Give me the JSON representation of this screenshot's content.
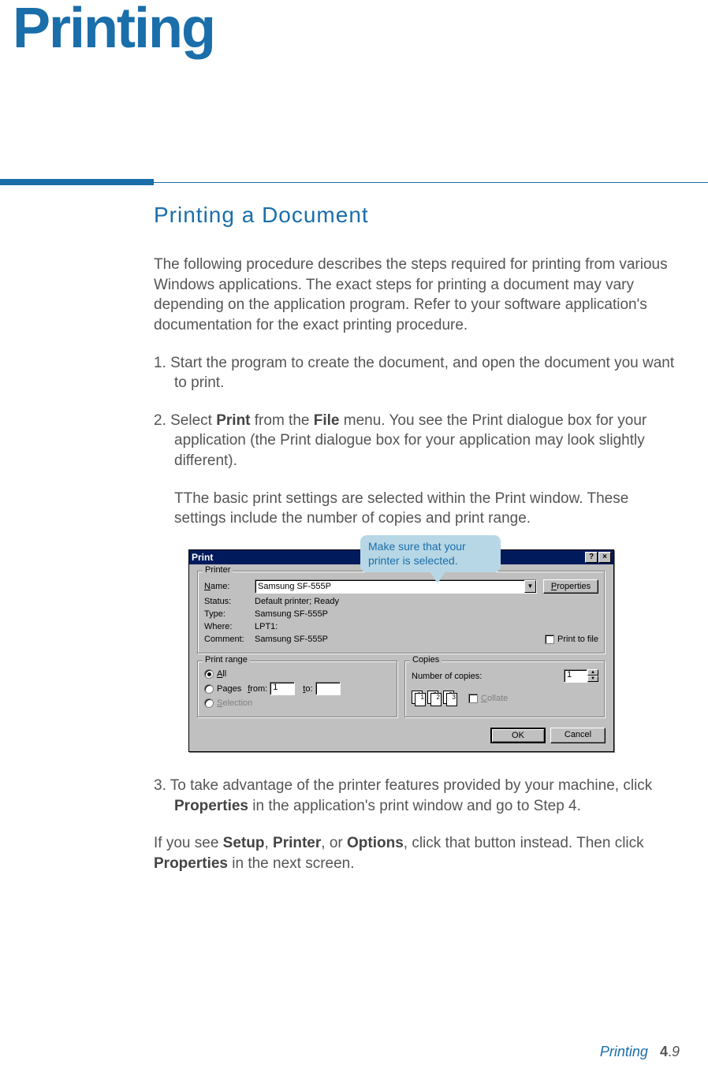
{
  "chapter_title": "Printing",
  "section_title": "Printing a Document",
  "intro": "The following procedure describes the steps required for printing from various Windows applications. The exact steps for printing a document may vary depending on the application program. Refer to your software application's documentation for the exact printing procedure.",
  "step1": "1. Start the program to create the document, and open the document you want to print.",
  "step2_pre": "2. Select ",
  "step2_b1": "Print",
  "step2_mid1": " from the ",
  "step2_b2": "File",
  "step2_post": " menu. You see the Print dialogue box for your application (the Print dialogue box for your application may look slightly different).",
  "step2_sub": "TThe basic print settings are selected within the Print window. These settings include the number of copies and print range.",
  "callout": "Make sure that your printer is selected.",
  "dialog": {
    "title": "Print",
    "help_btn": "?",
    "close_btn": "×",
    "printer_group": "Printer",
    "name_label": "Name:",
    "name_value": "Samsung SF-555P",
    "properties_btn": "Properties",
    "status_label": "Status:",
    "status_value": "Default printer; Ready",
    "type_label": "Type:",
    "type_value": "Samsung SF-555P",
    "where_label": "Where:",
    "where_value": "LPT1:",
    "comment_label": "Comment:",
    "comment_value": "Samsung SF-555P",
    "print_to_file": "Print to file",
    "range_group": "Print range",
    "range_all": "All",
    "range_pages": "Pages",
    "from_label": "from:",
    "from_value": "1",
    "to_label": "to:",
    "to_value": "",
    "range_selection": "Selection",
    "copies_group": "Copies",
    "copies_label": "Number of copies:",
    "copies_value": "1",
    "collate": "Collate",
    "ok": "OK",
    "cancel": "Cancel",
    "ci1a": "1",
    "ci1b": "1",
    "ci2a": "2",
    "ci2b": "2",
    "ci3a": "3",
    "ci3b": "3"
  },
  "step3_pre": "3. To take advantage of the printer features provided by your machine, click ",
  "step3_b1": "Properties",
  "step3_post": " in the application's print window and go to Step 4.",
  "step_alt_pre": "If you see ",
  "step_alt_b1": "Setup",
  "step_alt_m1": ", ",
  "step_alt_b2": "Printer",
  "step_alt_m2": ", or ",
  "step_alt_b3": "Options",
  "step_alt_m3": ", click that button instead. Then click ",
  "step_alt_b4": "Properties",
  "step_alt_post": " in the next screen.",
  "footer_label": "Printing",
  "footer_page_ch": "4",
  "footer_page_dot": ".",
  "footer_page_no": "9"
}
